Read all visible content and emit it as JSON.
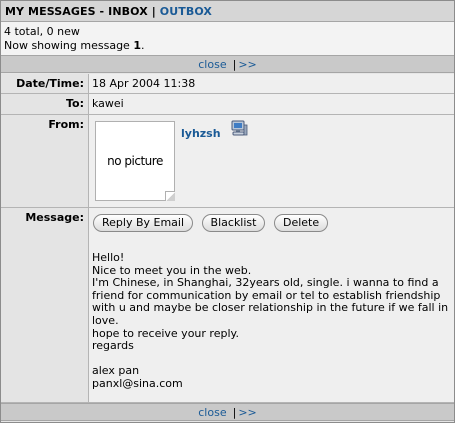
{
  "header": {
    "title": "MY MESSAGES - INBOX",
    "separator": "|",
    "outbox_link": "OUTBOX"
  },
  "summary": {
    "counts": "4 total, 0 new",
    "showing_prefix": "Now showing message ",
    "current_message": "1",
    "showing_suffix": "."
  },
  "nav": {
    "close_label": "close",
    "separator": "|",
    "next_label": ">>"
  },
  "message": {
    "date_label": "Date/Time:",
    "date_value": "18 Apr 2004 11:38",
    "to_label": "To:",
    "to_value": "kawei",
    "from_label": "From:",
    "from_username": "lyhzsh",
    "from_picture_text": "no picture",
    "message_label": "Message:",
    "buttons": {
      "reply": "Reply By Email",
      "blacklist": "Blacklist",
      "delete": "Delete"
    },
    "body": "Hello!\nNice to meet you in the web.\nI'm Chinese, in Shanghai, 32years old, single. i wanna to find a friend for communication by email or tel to establish friendship with u and maybe be closer relationship in the future if we fall in love.\nhope to receive your reply.\nregards\n\nalex pan\npanxl@sina.com"
  },
  "icons": {
    "online_status": "computer-icon",
    "picture_corner": "page-fold-icon"
  },
  "colors": {
    "link": "#1a5a96",
    "header_bg": "#d6d6d6",
    "nav_bg": "#c9c9c9",
    "label_bg": "#e4e4e4",
    "value_bg": "#efefef"
  }
}
